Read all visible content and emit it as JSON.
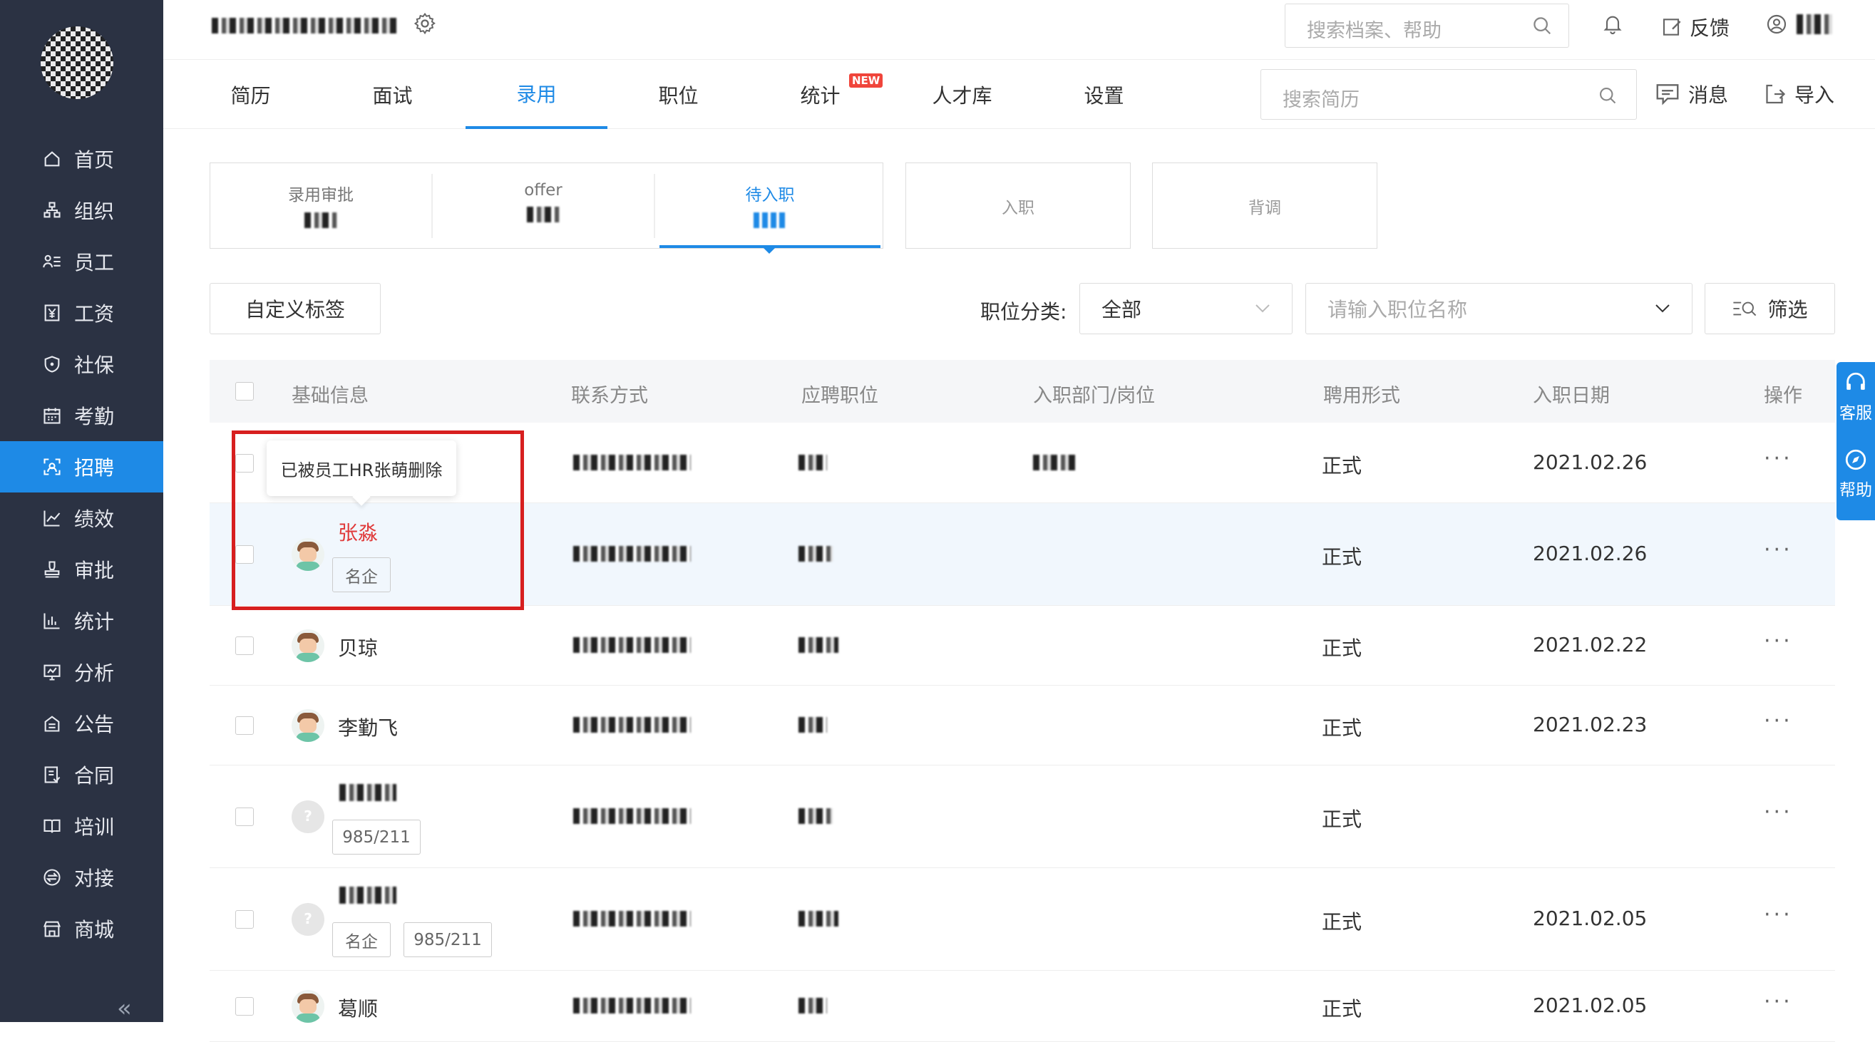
{
  "sidebar": {
    "items": [
      {
        "label": "首页",
        "icon": "home-icon"
      },
      {
        "label": "组织",
        "icon": "org-icon"
      },
      {
        "label": "员工",
        "icon": "staff-icon"
      },
      {
        "label": "工资",
        "icon": "salary-icon"
      },
      {
        "label": "社保",
        "icon": "shield-icon"
      },
      {
        "label": "考勤",
        "icon": "calendar-icon"
      },
      {
        "label": "招聘",
        "icon": "recruit-icon"
      },
      {
        "label": "绩效",
        "icon": "chart-line-icon"
      },
      {
        "label": "审批",
        "icon": "stamp-icon"
      },
      {
        "label": "统计",
        "icon": "bar-chart-icon"
      },
      {
        "label": "分析",
        "icon": "analysis-icon"
      },
      {
        "label": "公告",
        "icon": "notice-icon"
      },
      {
        "label": "合同",
        "icon": "contract-icon"
      },
      {
        "label": "培训",
        "icon": "book-icon"
      },
      {
        "label": "对接",
        "icon": "exchange-icon"
      },
      {
        "label": "商城",
        "icon": "shop-icon"
      }
    ],
    "active_index": 6,
    "collapse": "«"
  },
  "topbar": {
    "search_placeholder": "搜索档案、帮助",
    "feedback": "反馈"
  },
  "tabs": [
    {
      "label": "简历"
    },
    {
      "label": "面试"
    },
    {
      "label": "录用"
    },
    {
      "label": "职位"
    },
    {
      "label": "统计",
      "badge": "NEW"
    },
    {
      "label": "人才库"
    },
    {
      "label": "设置"
    }
  ],
  "tab_actions": {
    "search_placeholder": "搜索简历",
    "messages": "消息",
    "import": "导入"
  },
  "stages": [
    {
      "label": "录用审批"
    },
    {
      "label": "offer"
    },
    {
      "label": "待入职"
    },
    {
      "label": "入职"
    },
    {
      "label": "背调"
    }
  ],
  "filters": {
    "custom_tag": "自定义标签",
    "category_label": "职位分类:",
    "category_value": "全部",
    "position_placeholder": "请输入职位名称",
    "filter_button": "筛选"
  },
  "table": {
    "headers": [
      "基础信息",
      "联系方式",
      "应聘职位",
      "入职部门/岗位",
      "聘用形式",
      "入职日期",
      "操作"
    ],
    "rows": [
      {
        "name": "",
        "tags": [],
        "type": "正式",
        "date": "2021.02.26",
        "avatar": "person"
      },
      {
        "name": "张淼",
        "tags": [
          "名企"
        ],
        "type": "正式",
        "date": "2021.02.26",
        "avatar": "person"
      },
      {
        "name": "贝琼",
        "tags": [],
        "type": "正式",
        "date": "2021.02.22",
        "avatar": "person"
      },
      {
        "name": "李勤飞",
        "tags": [],
        "type": "正式",
        "date": "2021.02.23",
        "avatar": "person"
      },
      {
        "name": "",
        "tags": [
          "985/211"
        ],
        "type": "正式",
        "date": "",
        "avatar": "unknown"
      },
      {
        "name": "",
        "tags": [
          "名企",
          "985/211"
        ],
        "type": "正式",
        "date": "2021.02.05",
        "avatar": "unknown"
      },
      {
        "name": "葛顺",
        "tags": [],
        "type": "正式",
        "date": "2021.02.05",
        "avatar": "person"
      }
    ]
  },
  "tooltip": "已被员工HR张萌删除",
  "float_help": {
    "service": "客服",
    "help": "帮助"
  },
  "colors": {
    "accent": "#1e8ae6",
    "sidebar": "#2b3243",
    "highlight_red": "#d71f1f"
  }
}
